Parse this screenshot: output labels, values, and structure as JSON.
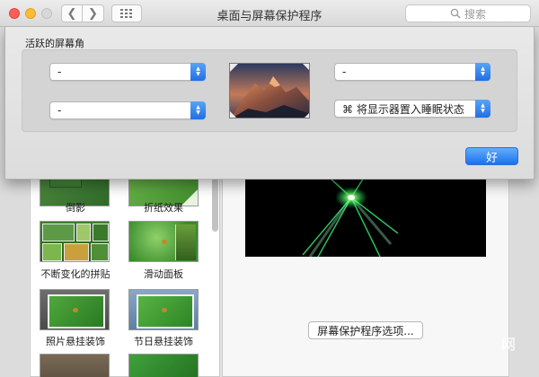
{
  "window": {
    "title": "桌面与屏幕保护程序",
    "search_placeholder": "搜索",
    "back_glyph": "❮",
    "forward_glyph": "❯",
    "icons": [
      "back-chevron-icon",
      "forward-chevron-icon",
      "show-all-grid-icon",
      "search-icon"
    ]
  },
  "hot_corners": {
    "heading": "活跃的屏幕角",
    "top_left": "-",
    "bottom_left": "-",
    "top_right": "-",
    "bottom_right": "⌘ 将显示器置入睡眠状态",
    "ok_label": "好"
  },
  "screensavers": [
    {
      "name": "倒影"
    },
    {
      "name": "折纸效果"
    },
    {
      "name": "不断变化的拼贴"
    },
    {
      "name": "滑动面板"
    },
    {
      "name": "照片悬挂装饰"
    },
    {
      "name": "节日悬挂装饰"
    }
  ],
  "preview": {
    "options_button": "屏幕保护程序选项..."
  },
  "watermark": "网",
  "colors": {
    "accent_blue": "#1f6fe6",
    "close": "#ff5f57",
    "minimize": "#febc2e"
  }
}
